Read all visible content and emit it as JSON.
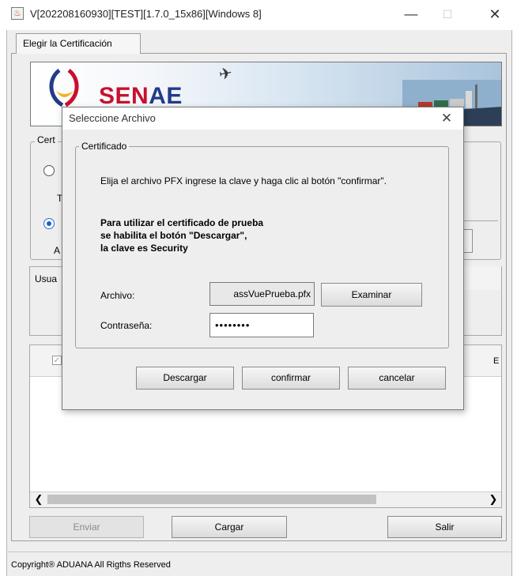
{
  "window": {
    "title": "V[202208160930][TEST][1.7.0_15x86][Windows 8]",
    "minimize_glyph": "—",
    "maximize_glyph": "☐",
    "close_glyph": "✕"
  },
  "tabs": [
    {
      "label": "Elegir la Certificación",
      "selected": true
    }
  ],
  "banner": {
    "logo_text": "SENAE",
    "logo_colors": {
      "blue": "#233a8a",
      "red": "#c8102e",
      "yellow": "#f2b320"
    }
  },
  "background": {
    "cert_group_title_partial": "Cert",
    "radio1_label_partial": "T",
    "radio2_label_partial": "A",
    "usuario_label_partial": "Usua",
    "header_col_partial": "E"
  },
  "buttons": {
    "enviar": "Enviar",
    "cargar": "Cargar",
    "salir": "Salir"
  },
  "footer": {
    "copyright": "Copyright® ADUANA All Rigths Reserved"
  },
  "dialog": {
    "title": "Seleccione Archivo",
    "close_glyph": "✕",
    "group_title": "Certificado",
    "instruction": "Elija el archivo PFX ingrese la clave y haga clic al botón \"confirmar\".",
    "note": "Para utilizar el certificado de prueba\nse habilita el botón \"Descargar\",\nla clave es Security",
    "archivo_label": "Archivo:",
    "archivo_value": "assVuePrueba.pfx",
    "examinar_label": "Examinar",
    "password_label": "Contraseña:",
    "password_value": "secretos",
    "descargar_label": "Descargar",
    "confirmar_label": "confirmar",
    "cancelar_label": "cancelar"
  }
}
